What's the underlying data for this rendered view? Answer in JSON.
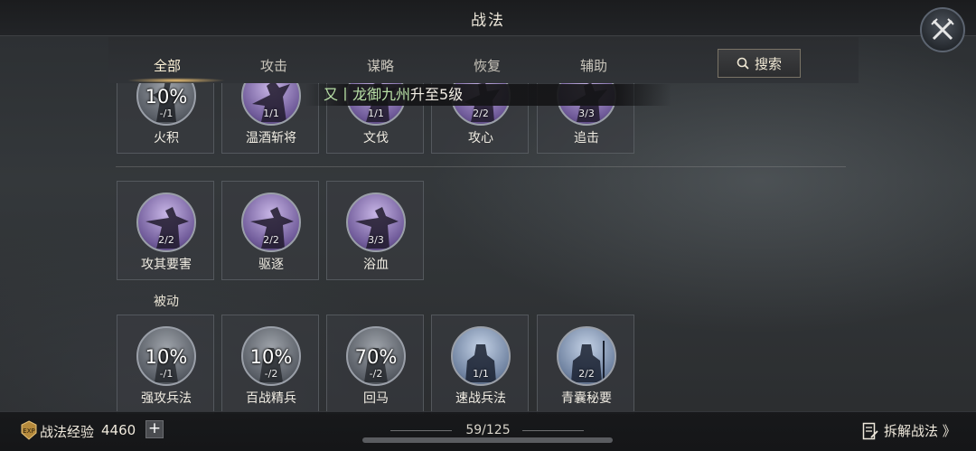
{
  "header": {
    "title": "战法"
  },
  "tabs": [
    {
      "label": "全部",
      "active": true
    },
    {
      "label": "攻击",
      "active": false
    },
    {
      "label": "谋略",
      "active": false
    },
    {
      "label": "恢复",
      "active": false
    },
    {
      "label": "辅助",
      "active": false
    }
  ],
  "search": {
    "label": "搜索",
    "icon": "magnifier-icon"
  },
  "notice": {
    "highlight": "又丨龙御九州",
    "text": "升至5级"
  },
  "cards_row1": [
    {
      "name": "火积",
      "percent": "10%",
      "count": "-/1",
      "style": "grey"
    },
    {
      "name": "温酒斩将",
      "percent": "",
      "count": "1/1",
      "style": "purple"
    },
    {
      "name": "文伐",
      "percent": "",
      "count": "1/1",
      "style": "purple"
    },
    {
      "name": "攻心",
      "percent": "",
      "count": "2/2",
      "style": "purple"
    },
    {
      "name": "追击",
      "percent": "",
      "count": "3/3",
      "style": "purple"
    }
  ],
  "cards_row2": [
    {
      "name": "攻其要害",
      "percent": "",
      "count": "2/2",
      "style": "purple"
    },
    {
      "name": "驱逐",
      "percent": "",
      "count": "2/2",
      "style": "purple"
    },
    {
      "name": "浴血",
      "percent": "",
      "count": "3/3",
      "style": "purple"
    }
  ],
  "section": {
    "passive_label": "被动"
  },
  "cards_row3": [
    {
      "name": "强攻兵法",
      "percent": "10%",
      "count": "-/1",
      "style": "grey"
    },
    {
      "name": "百战精兵",
      "percent": "10%",
      "count": "-/2",
      "style": "grey"
    },
    {
      "name": "回马",
      "percent": "70%",
      "count": "-/2",
      "style": "grey"
    },
    {
      "name": "速战兵法",
      "percent": "",
      "count": "1/1",
      "style": "blue"
    },
    {
      "name": "青囊秘要",
      "percent": "",
      "count": "2/2",
      "style": "blue"
    }
  ],
  "footer": {
    "exp_label": "战法经验",
    "exp_value": "4460",
    "plus_label": "+",
    "page_count": "59/125",
    "disassemble_label": "拆解战法 》"
  },
  "colors": {
    "accent_gold": "#ffce78",
    "notice_green": "#b8e0a6"
  }
}
